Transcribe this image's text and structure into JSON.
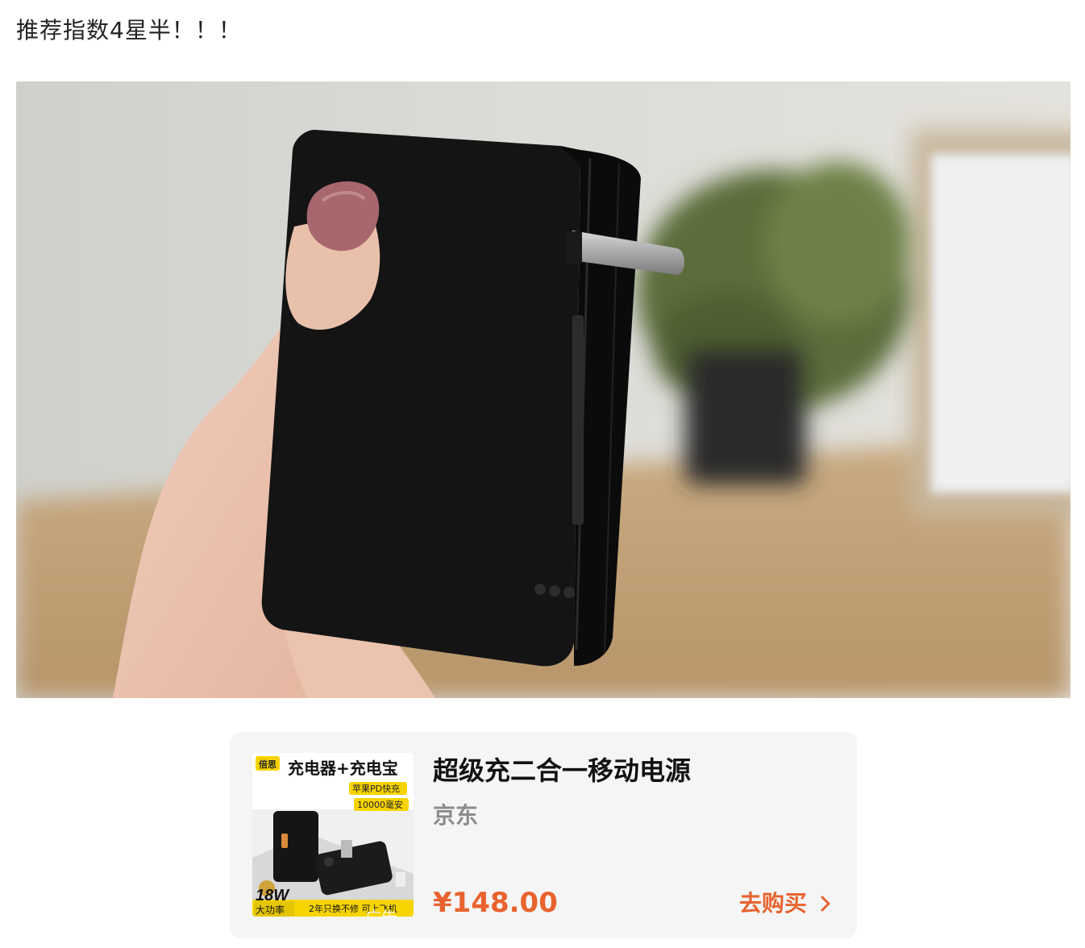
{
  "headline": "推荐指数4星半！！！",
  "photo": {
    "icon": "product-photo"
  },
  "product": {
    "title": "超级充二合一移动电源",
    "shop": "京东",
    "price": "¥148.00",
    "buy_label": "去购买",
    "thumb": {
      "brand": "倍思",
      "banner": "充电器+充电宝",
      "tag1": "苹果PD快充",
      "tag2": "10000毫安",
      "power": "18W",
      "power_sub": "大功率",
      "bottom": "2年只换不修  可上飞机",
      "ad": "广告"
    }
  },
  "colors": {
    "accent": "#e8632f",
    "card_bg": "#f5f5f5"
  }
}
